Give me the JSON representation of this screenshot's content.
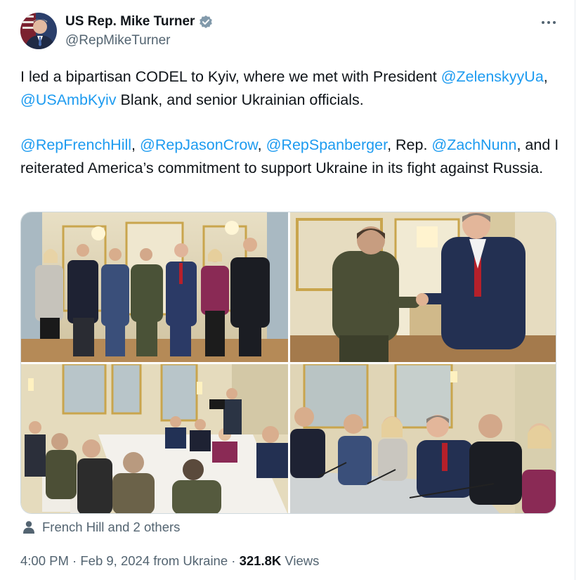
{
  "author": {
    "display_name": "US Rep. Mike Turner",
    "handle": "@RepMikeTurner",
    "verified_color": "#829aab"
  },
  "tweet": {
    "line1_a": "I led a bipartisan CODEL to Kyiv, where we met with President",
    "mention_zelensky": "@ZelenskyyUa",
    "comma1": ",",
    "mention_usamb": "@USAmbKyiv",
    "line2_rest": "Blank, and senior Ukrainian officials.",
    "mention_hill": "@RepFrenchHill",
    "comma2": ",",
    "mention_crow": "@RepJasonCrow",
    "comma3": ",",
    "mention_spanberger": "@RepSpanberger",
    "rep_text": ", Rep.",
    "mention_nunn": "@ZachNunn",
    "comma4": ",",
    "para2_rest": "and I reiterated America’s commitment to support Ukraine in its fight against Russia."
  },
  "tagged": {
    "icon": "person-icon",
    "label": "French Hill and 2 others"
  },
  "meta": {
    "time": "4:00 PM",
    "sep1": " · ",
    "date": "Feb 9, 2024",
    "source": " from Ukraine",
    "sep2": " · ",
    "views_count": "321.8K",
    "views_label": " Views"
  },
  "colors": {
    "link": "#1d9bf0",
    "secondary": "#536471",
    "text": "#0f1419"
  }
}
